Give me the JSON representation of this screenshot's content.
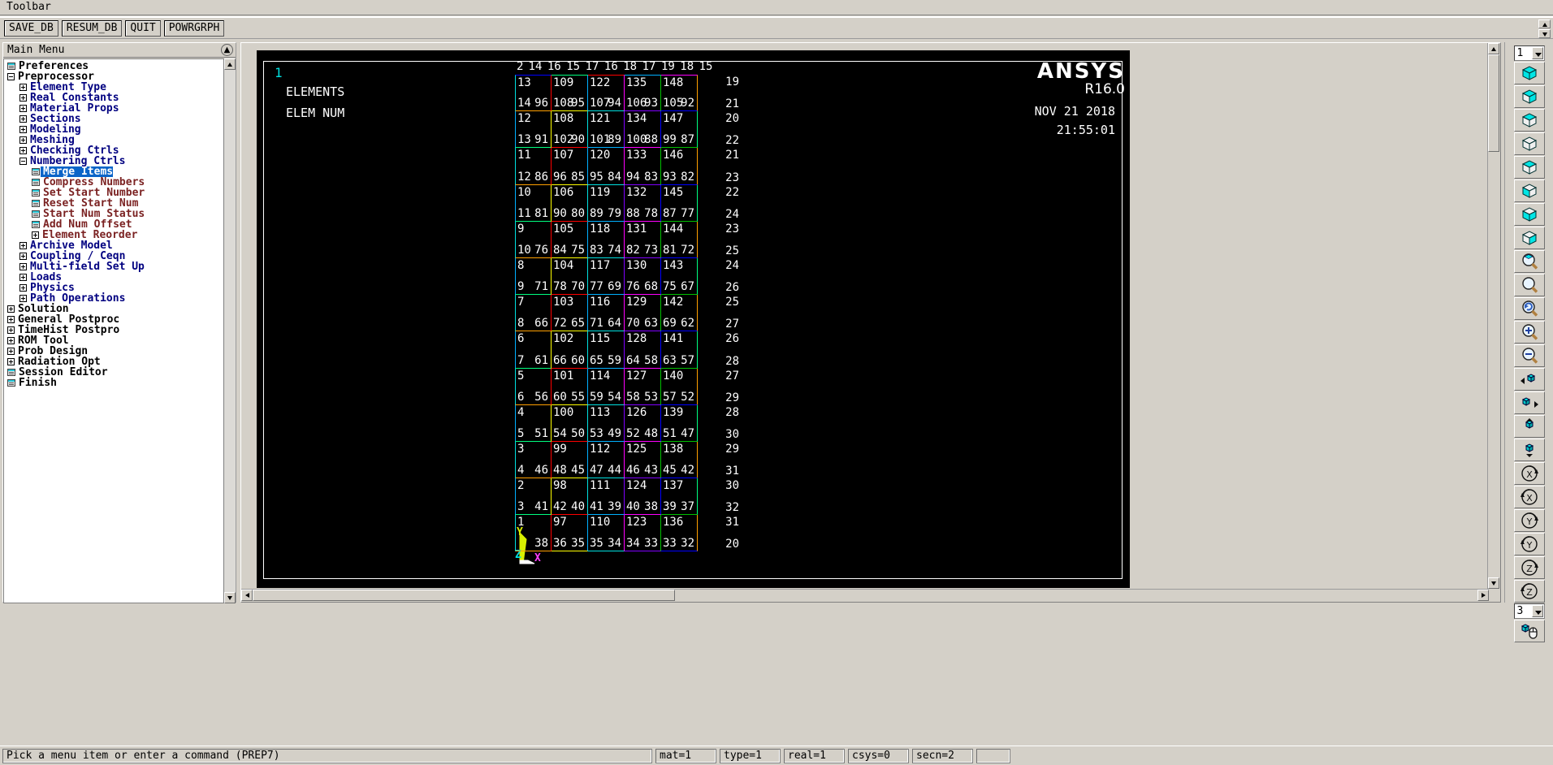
{
  "toolbar": {
    "title": "Toolbar",
    "buttons": [
      {
        "label": "SAVE_DB",
        "name": "save-db-button"
      },
      {
        "label": "RESUM_DB",
        "name": "resume-db-button"
      },
      {
        "label": "QUIT",
        "name": "quit-button"
      },
      {
        "label": "POWRGRPH",
        "name": "powrgraph-button"
      }
    ]
  },
  "main_menu": {
    "title": "Main Menu",
    "collapse_icon": "chevron-up-icon",
    "items": [
      {
        "label": "Preferences",
        "level": 0,
        "marker": "leaf",
        "color": "c-black",
        "selected": false
      },
      {
        "label": "Preprocessor",
        "level": 0,
        "marker": "minus",
        "color": "c-black",
        "selected": false
      },
      {
        "label": "Element Type",
        "level": 1,
        "marker": "plus",
        "color": "c-blue",
        "selected": false
      },
      {
        "label": "Real Constants",
        "level": 1,
        "marker": "plus",
        "color": "c-blue",
        "selected": false
      },
      {
        "label": "Material Props",
        "level": 1,
        "marker": "plus",
        "color": "c-blue",
        "selected": false
      },
      {
        "label": "Sections",
        "level": 1,
        "marker": "plus",
        "color": "c-blue",
        "selected": false
      },
      {
        "label": "Modeling",
        "level": 1,
        "marker": "plus",
        "color": "c-blue",
        "selected": false
      },
      {
        "label": "Meshing",
        "level": 1,
        "marker": "plus",
        "color": "c-blue",
        "selected": false
      },
      {
        "label": "Checking Ctrls",
        "level": 1,
        "marker": "plus",
        "color": "c-blue",
        "selected": false
      },
      {
        "label": "Numbering Ctrls",
        "level": 1,
        "marker": "minus",
        "color": "c-blue",
        "selected": false
      },
      {
        "label": "Merge Items",
        "level": 2,
        "marker": "leaf",
        "color": "c-brown",
        "selected": true
      },
      {
        "label": "Compress Numbers",
        "level": 2,
        "marker": "leaf",
        "color": "c-brown",
        "selected": false
      },
      {
        "label": "Set Start Number",
        "level": 2,
        "marker": "leaf",
        "color": "c-brown",
        "selected": false
      },
      {
        "label": "Reset Start Num",
        "level": 2,
        "marker": "leaf",
        "color": "c-brown",
        "selected": false
      },
      {
        "label": "Start Num Status",
        "level": 2,
        "marker": "leaf",
        "color": "c-brown",
        "selected": false
      },
      {
        "label": "Add Num Offset",
        "level": 2,
        "marker": "leaf",
        "color": "c-brown",
        "selected": false
      },
      {
        "label": "Element Reorder",
        "level": 2,
        "marker": "plus",
        "color": "c-brown",
        "selected": false
      },
      {
        "label": "Archive Model",
        "level": 1,
        "marker": "plus",
        "color": "c-blue",
        "selected": false
      },
      {
        "label": "Coupling / Ceqn",
        "level": 1,
        "marker": "plus",
        "color": "c-blue",
        "selected": false
      },
      {
        "label": "Multi-field Set Up",
        "level": 1,
        "marker": "plus",
        "color": "c-blue",
        "selected": false
      },
      {
        "label": "Loads",
        "level": 1,
        "marker": "plus",
        "color": "c-blue",
        "selected": false
      },
      {
        "label": "Physics",
        "level": 1,
        "marker": "plus",
        "color": "c-blue",
        "selected": false
      },
      {
        "label": "Path Operations",
        "level": 1,
        "marker": "plus",
        "color": "c-blue",
        "selected": false
      },
      {
        "label": "Solution",
        "level": 0,
        "marker": "plus",
        "color": "c-black",
        "selected": false
      },
      {
        "label": "General Postproc",
        "level": 0,
        "marker": "plus",
        "color": "c-black",
        "selected": false
      },
      {
        "label": "TimeHist Postpro",
        "level": 0,
        "marker": "plus",
        "color": "c-black",
        "selected": false
      },
      {
        "label": "ROM Tool",
        "level": 0,
        "marker": "plus",
        "color": "c-black",
        "selected": false
      },
      {
        "label": "Prob Design",
        "level": 0,
        "marker": "plus",
        "color": "c-black",
        "selected": false
      },
      {
        "label": "Radiation Opt",
        "level": 0,
        "marker": "plus",
        "color": "c-black",
        "selected": false
      },
      {
        "label": "Session Editor",
        "level": 0,
        "marker": "leaf",
        "color": "c-black",
        "selected": false
      },
      {
        "label": "Finish",
        "level": 0,
        "marker": "leaf",
        "color": "c-black",
        "selected": false
      }
    ]
  },
  "graphics": {
    "window_number": "1",
    "title_lines": [
      "ELEMENTS",
      "ELEM NUM"
    ],
    "logo": {
      "name": "ANSYS",
      "release": "R16.0"
    },
    "date": "NOV 21 2018",
    "time": "21:55:01",
    "triad": {
      "x": "X",
      "y": "Y",
      "z": "Z"
    },
    "mesh": {
      "top_labels": [
        "2",
        "14",
        "16",
        "15",
        "17",
        "16",
        "18",
        "17",
        "19",
        "18",
        "15"
      ],
      "rows": [
        {
          "elems": [
            "13",
            "109",
            "122",
            "135",
            "148"
          ],
          "left": [
            "14",
            "108",
            "107",
            "106",
            "105"
          ],
          "right": [
            "96",
            "95",
            "94",
            "93",
            "92"
          ],
          "edge_top": "19",
          "edge_bottom": "21"
        },
        {
          "elems": [
            "12",
            "108",
            "121",
            "134",
            "147"
          ],
          "left": [
            "13",
            "102",
            "101",
            "100",
            "99"
          ],
          "right": [
            "91",
            "90",
            "89",
            "88",
            "87"
          ],
          "edge_top": "20",
          "edge_bottom": "22"
        },
        {
          "elems": [
            "11",
            "107",
            "120",
            "133",
            "146"
          ],
          "left": [
            "12",
            "96",
            "95",
            "94",
            "93"
          ],
          "right": [
            "86",
            "85",
            "84",
            "83",
            "82"
          ],
          "edge_top": "21",
          "edge_bottom": "23"
        },
        {
          "elems": [
            "10",
            "106",
            "119",
            "132",
            "145"
          ],
          "left": [
            "11",
            "90",
            "89",
            "88",
            "87"
          ],
          "right": [
            "81",
            "80",
            "79",
            "78",
            "77"
          ],
          "edge_top": "22",
          "edge_bottom": "24"
        },
        {
          "elems": [
            "9",
            "105",
            "118",
            "131",
            "144"
          ],
          "left": [
            "10",
            "84",
            "83",
            "82",
            "81"
          ],
          "right": [
            "76",
            "75",
            "74",
            "73",
            "72"
          ],
          "edge_top": "23",
          "edge_bottom": "25"
        },
        {
          "elems": [
            "8",
            "104",
            "117",
            "130",
            "143"
          ],
          "left": [
            "9",
            "78",
            "77",
            "76",
            "75"
          ],
          "right": [
            "71",
            "70",
            "69",
            "68",
            "67"
          ],
          "edge_top": "24",
          "edge_bottom": "26"
        },
        {
          "elems": [
            "7",
            "103",
            "116",
            "129",
            "142"
          ],
          "left": [
            "8",
            "72",
            "71",
            "70",
            "69"
          ],
          "right": [
            "66",
            "65",
            "64",
            "63",
            "62"
          ],
          "edge_top": "25",
          "edge_bottom": "27"
        },
        {
          "elems": [
            "6",
            "102",
            "115",
            "128",
            "141"
          ],
          "left": [
            "7",
            "66",
            "65",
            "64",
            "63"
          ],
          "right": [
            "61",
            "60",
            "59",
            "58",
            "57"
          ],
          "edge_top": "26",
          "edge_bottom": "28"
        },
        {
          "elems": [
            "5",
            "101",
            "114",
            "127",
            "140"
          ],
          "left": [
            "6",
            "60",
            "59",
            "58",
            "57"
          ],
          "right": [
            "56",
            "55",
            "54",
            "53",
            "52"
          ],
          "edge_top": "27",
          "edge_bottom": "29"
        },
        {
          "elems": [
            "4",
            "100",
            "113",
            "126",
            "139"
          ],
          "left": [
            "5",
            "54",
            "53",
            "52",
            "51"
          ],
          "right": [
            "51",
            "50",
            "49",
            "48",
            "47"
          ],
          "edge_top": "28",
          "edge_bottom": "30"
        },
        {
          "elems": [
            "3",
            "99",
            "112",
            "125",
            "138"
          ],
          "left": [
            "4",
            "48",
            "47",
            "46",
            "45"
          ],
          "right": [
            "46",
            "45",
            "44",
            "43",
            "42"
          ],
          "edge_top": "29",
          "edge_bottom": "31"
        },
        {
          "elems": [
            "2",
            "98",
            "111",
            "124",
            "137"
          ],
          "left": [
            "3",
            "42",
            "41",
            "40",
            "39"
          ],
          "right": [
            "41",
            "40",
            "39",
            "38",
            "37"
          ],
          "edge_top": "30",
          "edge_bottom": "32"
        },
        {
          "elems": [
            "1",
            "97",
            "110",
            "123",
            "136"
          ],
          "left": [
            "",
            "36",
            "35",
            "34",
            "33"
          ],
          "right": [
            "38",
            "35",
            "34",
            "33",
            "32"
          ],
          "edge_top": "31",
          "edge_bottom": "20"
        }
      ]
    }
  },
  "right_toolbar": {
    "view_select_top": "1",
    "view_select_bottom": "3",
    "buttons": [
      {
        "name": "isometric-view-icon",
        "glyph": "cube-iso"
      },
      {
        "name": "oblique-view-icon",
        "glyph": "cube-oblique"
      },
      {
        "name": "front-view-icon",
        "glyph": "cube-front"
      },
      {
        "name": "back-view-icon",
        "glyph": "cube-back"
      },
      {
        "name": "top-view-icon",
        "glyph": "cube-top"
      },
      {
        "name": "bottom-view-icon",
        "glyph": "cube-bottom"
      },
      {
        "name": "left-view-icon",
        "glyph": "cube-left"
      },
      {
        "name": "right-view-icon",
        "glyph": "cube-right"
      },
      {
        "name": "fit-view-icon",
        "glyph": "zoom-fit"
      },
      {
        "name": "zoom-box-icon",
        "glyph": "zoom-plain"
      },
      {
        "name": "back-up-zoom-icon",
        "glyph": "zoom-back"
      },
      {
        "name": "zoom-in-icon",
        "glyph": "zoom-in"
      },
      {
        "name": "zoom-out-icon",
        "glyph": "zoom-out"
      },
      {
        "name": "pan-left-icon",
        "glyph": "pan-left"
      },
      {
        "name": "pan-right-icon",
        "glyph": "pan-right"
      },
      {
        "name": "pan-up-icon",
        "glyph": "pan-up"
      },
      {
        "name": "pan-down-icon",
        "glyph": "pan-down"
      },
      {
        "name": "rotate-x-plus-icon",
        "glyph": "rot-x-plus"
      },
      {
        "name": "rotate-x-minus-icon",
        "glyph": "rot-x-minus"
      },
      {
        "name": "rotate-y-plus-icon",
        "glyph": "rot-y-plus"
      },
      {
        "name": "rotate-y-minus-icon",
        "glyph": "rot-y-minus"
      },
      {
        "name": "rotate-z-plus-icon",
        "glyph": "rot-z-plus"
      },
      {
        "name": "rotate-z-minus-icon",
        "glyph": "rot-z-minus"
      }
    ],
    "dynamic_mode_icon": "dynamic-mode-mouse-icon"
  },
  "status_bar": {
    "prompt": "Pick a menu item or enter a command (PREP7)",
    "fields": [
      {
        "name": "mat-field",
        "value": "mat=1"
      },
      {
        "name": "type-field",
        "value": "type=1"
      },
      {
        "name": "real-field",
        "value": "real=1"
      },
      {
        "name": "csys-field",
        "value": "csys=0"
      },
      {
        "name": "secn-field",
        "value": "secn=2"
      }
    ]
  },
  "colors": {
    "mesh_palette": [
      "#ff0000",
      "#00b0ff",
      "#ff00ff",
      "#00c000",
      "#ffa000",
      "#ffff00",
      "#00e0e0",
      "#8000ff",
      "#0000ff",
      "#00ff80"
    ],
    "highlight": "#0a64c8",
    "menu_blue": "#000080",
    "menu_brown": "#7b2222",
    "canvas_bg": "#000000"
  }
}
